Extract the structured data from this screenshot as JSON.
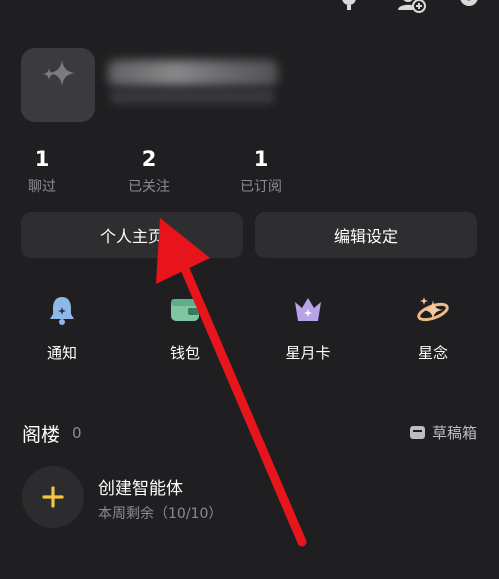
{
  "header": {
    "icons": [
      "trophy-icon",
      "add-friend-icon",
      "settings-icon"
    ]
  },
  "profile": {
    "avatar_icon": "sparkle-icon"
  },
  "stats": [
    {
      "value": "1",
      "label": "聊过"
    },
    {
      "value": "2",
      "label": "已关注"
    },
    {
      "value": "1",
      "label": "已订阅"
    }
  ],
  "actions": {
    "profile_label": "个人主页",
    "edit_label": "编辑设定"
  },
  "tiles": [
    {
      "label": "通知",
      "icon": "bell-icon"
    },
    {
      "label": "钱包",
      "icon": "wallet-icon"
    },
    {
      "label": "星月卡",
      "icon": "crown-icon"
    },
    {
      "label": "星念",
      "icon": "planet-star-icon"
    }
  ],
  "attic": {
    "title": "阁楼",
    "count": "0",
    "drafts_label": "草稿箱"
  },
  "create": {
    "title": "创建智能体",
    "subtitle": "本周剩余（10/10）"
  },
  "colors": {
    "background": "#1f1f21",
    "card": "#2e2e31",
    "accent_yellow": "#f5c542",
    "annotation_red": "#e8141b"
  }
}
